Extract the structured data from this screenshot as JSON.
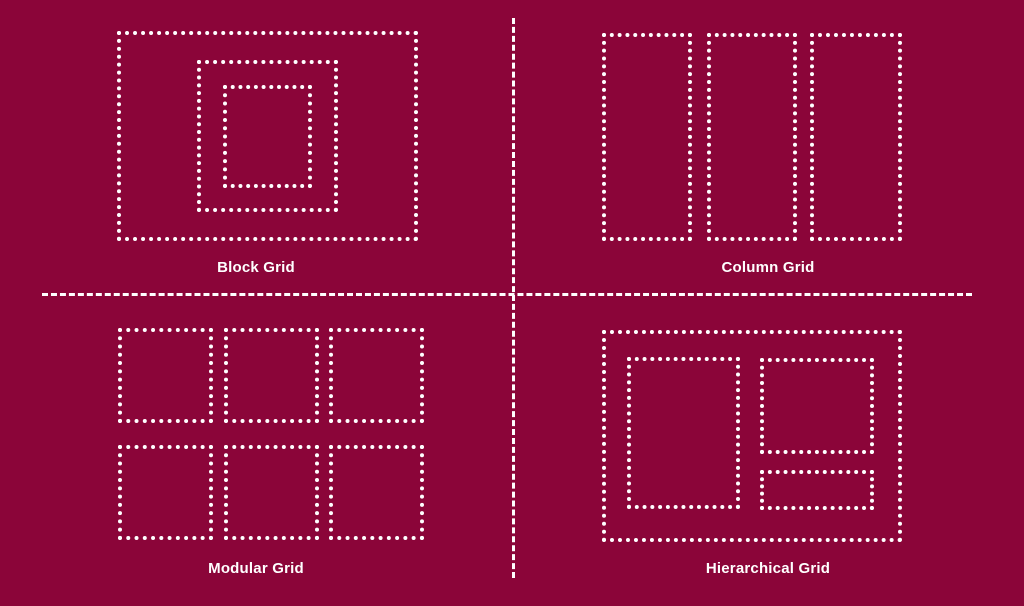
{
  "theme": {
    "background_color": "#8B0539",
    "stroke_color": "#FFFFFF",
    "label_color": "#FFFFFF"
  },
  "diagram": {
    "title_present": false,
    "layout": "2x2 quadrants separated by dashed cross divider",
    "quadrants": [
      {
        "id": "block-grid",
        "label": "Block Grid",
        "position": "top-left",
        "shapes": [
          {
            "name": "outer-block",
            "type": "rectangle"
          },
          {
            "name": "middle-block",
            "type": "rectangle"
          },
          {
            "name": "inner-block",
            "type": "rectangle"
          }
        ]
      },
      {
        "id": "column-grid",
        "label": "Column Grid",
        "position": "top-right",
        "shapes": [
          {
            "name": "column-1",
            "type": "rectangle"
          },
          {
            "name": "column-2",
            "type": "rectangle"
          },
          {
            "name": "column-3",
            "type": "rectangle"
          }
        ]
      },
      {
        "id": "modular-grid",
        "label": "Modular Grid",
        "position": "bottom-left",
        "shapes": [
          {
            "name": "module-1-1",
            "type": "square"
          },
          {
            "name": "module-1-2",
            "type": "square"
          },
          {
            "name": "module-1-3",
            "type": "square"
          },
          {
            "name": "module-2-1",
            "type": "square"
          },
          {
            "name": "module-2-2",
            "type": "square"
          },
          {
            "name": "module-2-3",
            "type": "square"
          }
        ]
      },
      {
        "id": "hierarchical-grid",
        "label": "Hierarchical Grid",
        "position": "bottom-right",
        "shapes": [
          {
            "name": "container",
            "type": "rectangle"
          },
          {
            "name": "primary-region",
            "type": "rectangle"
          },
          {
            "name": "secondary-region",
            "type": "rectangle"
          },
          {
            "name": "tertiary-region",
            "type": "rectangle"
          }
        ]
      }
    ],
    "captions": {
      "block": "Block Grid",
      "column": "Column Grid",
      "modular": "Modular Grid",
      "hierarchical": "Hierarchical Grid"
    }
  }
}
